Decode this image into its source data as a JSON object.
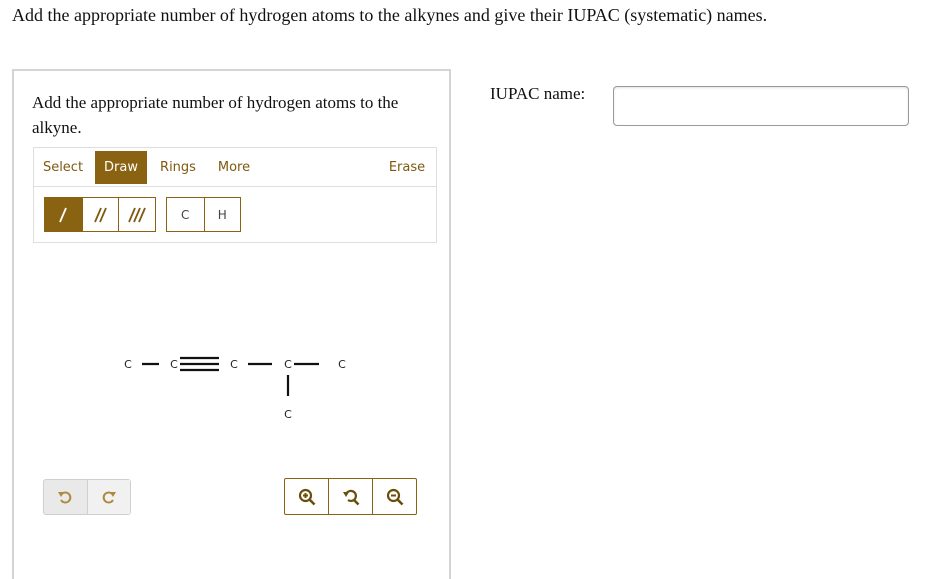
{
  "question": "Add the appropriate number of hydrogen atoms to the alkynes and give their IUPAC (systematic) names.",
  "prompt": "Add the appropriate number of hydrogen atoms to the alkyne.",
  "tabs": [
    "Select",
    "Draw",
    "Rings",
    "More",
    "Erase"
  ],
  "active_tab": "Draw",
  "bond_tools": [
    "single-bond",
    "double-bond",
    "triple-bond"
  ],
  "atom_tools": [
    "C",
    "H"
  ],
  "molecule": {
    "atoms": [
      {
        "id": "a1",
        "label": "C"
      },
      {
        "id": "a2",
        "label": "C"
      },
      {
        "id": "a3",
        "label": "C"
      },
      {
        "id": "a4",
        "label": "C"
      },
      {
        "id": "a5",
        "label": "C"
      },
      {
        "id": "a6",
        "label": "C"
      }
    ],
    "bonds": [
      {
        "from": "a1",
        "to": "a2",
        "order": 1
      },
      {
        "from": "a2",
        "to": "a3",
        "order": 3
      },
      {
        "from": "a3",
        "to": "a4",
        "order": 1
      },
      {
        "from": "a4",
        "to": "a5",
        "order": 1
      },
      {
        "from": "a4",
        "to": "a6",
        "order": 1
      }
    ]
  },
  "history_buttons": [
    "undo",
    "redo"
  ],
  "zoom_buttons": [
    "zoom-in",
    "reset-zoom",
    "zoom-out"
  ],
  "iupac": {
    "label": "IUPAC name:",
    "value": ""
  },
  "colors": {
    "accent": "#8a6312",
    "border": "#d4d4d4"
  }
}
